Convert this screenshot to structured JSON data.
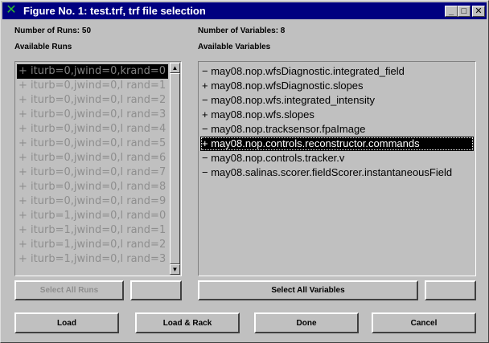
{
  "window": {
    "title": "Figure No. 1: test.trf, trf file selection",
    "minimize_glyph": "_",
    "maximize_glyph": "□",
    "close_glyph": "✕",
    "app_icon_glyph": "✕"
  },
  "runs": {
    "count_label": "Number of Runs: 50",
    "heading": "Available Runs",
    "items": [
      "+ iturb=0,jwind=0,krand=0",
      "+ iturb=0,jwind=0,l rand=1",
      "+ iturb=0,jwind=0,l rand=2",
      "+ iturb=0,jwind=0,l rand=3",
      "+ iturb=0,jwind=0,l rand=4",
      "+ iturb=0,jwind=0,l rand=5",
      "+ iturb=0,jwind=0,l rand=6",
      "+ iturb=0,jwind=0,l rand=7",
      "+ iturb=0,jwind=0,l rand=8",
      "+ iturb=0,jwind=0,l rand=9",
      "+ iturb=1,jwind=0,l rand=0",
      "+ iturb=1,jwind=0,l rand=1",
      "+ iturb=1,jwind=0,l rand=2",
      "+ iturb=1,jwind=0,l rand=3"
    ],
    "select_all_label": "Select All Runs",
    "count_field_value": ""
  },
  "variables": {
    "count_label": "Number of Variables: 8",
    "heading": "Available Variables",
    "items": [
      "− may08.nop.wfsDiagnostic.integrated_field",
      "+ may08.nop.wfsDiagnostic.slopes",
      "− may08.nop.wfs.integrated_intensity",
      "+ may08.nop.wfs.slopes",
      "− may08.nop.tracksensor.fpaImage",
      "+ may08.nop.controls.reconstructor.commands",
      "− may08.nop.controls.tracker.v",
      "− may08.salinas.scorer.fieldScorer.instantaneousField"
    ],
    "select_all_label": "Select All Variables",
    "count_field_value": ""
  },
  "actions": {
    "load_label": "Load",
    "load_rack_label": "Load & Rack",
    "done_label": "Done",
    "cancel_label": "Cancel"
  },
  "icons": {
    "scroll_up": "up-arrow-icon",
    "scroll_down": "down-arrow-icon"
  },
  "colors": {
    "title_bar": "#000080",
    "face": "#c0c0c0",
    "disabled_text": "#8e8e8e",
    "selection": "#000000"
  }
}
